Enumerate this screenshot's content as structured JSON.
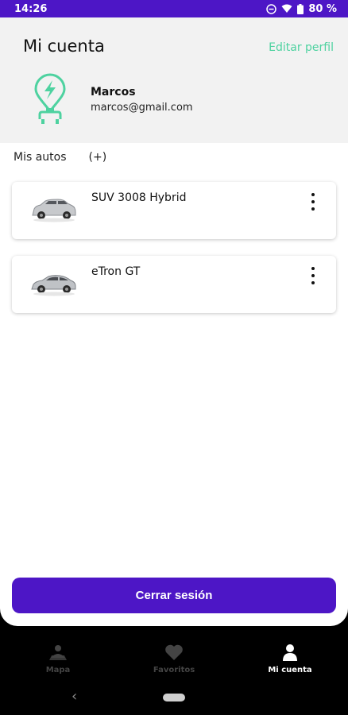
{
  "status": {
    "time": "14:26",
    "battery": "80 %"
  },
  "header": {
    "title": "Mi cuenta",
    "edit_label": "Editar perfil"
  },
  "user": {
    "name": "Marcos",
    "email": "marcos@gmail.com"
  },
  "cars_section": {
    "title": "Mis autos",
    "add_label": "(+)"
  },
  "cars": [
    {
      "name": "SUV 3008 Hybrid"
    },
    {
      "name": "eTron GT"
    }
  ],
  "logout_label": "Cerrar sesión",
  "bottom_nav": [
    {
      "label": "Mapa",
      "icon": "map-person-icon",
      "active": false
    },
    {
      "label": "Favoritos",
      "icon": "heart-icon",
      "active": false
    },
    {
      "label": "Mi cuenta",
      "icon": "person-icon",
      "active": true
    }
  ],
  "colors": {
    "primary": "#4d16c6",
    "accent": "#4ed2a0"
  }
}
